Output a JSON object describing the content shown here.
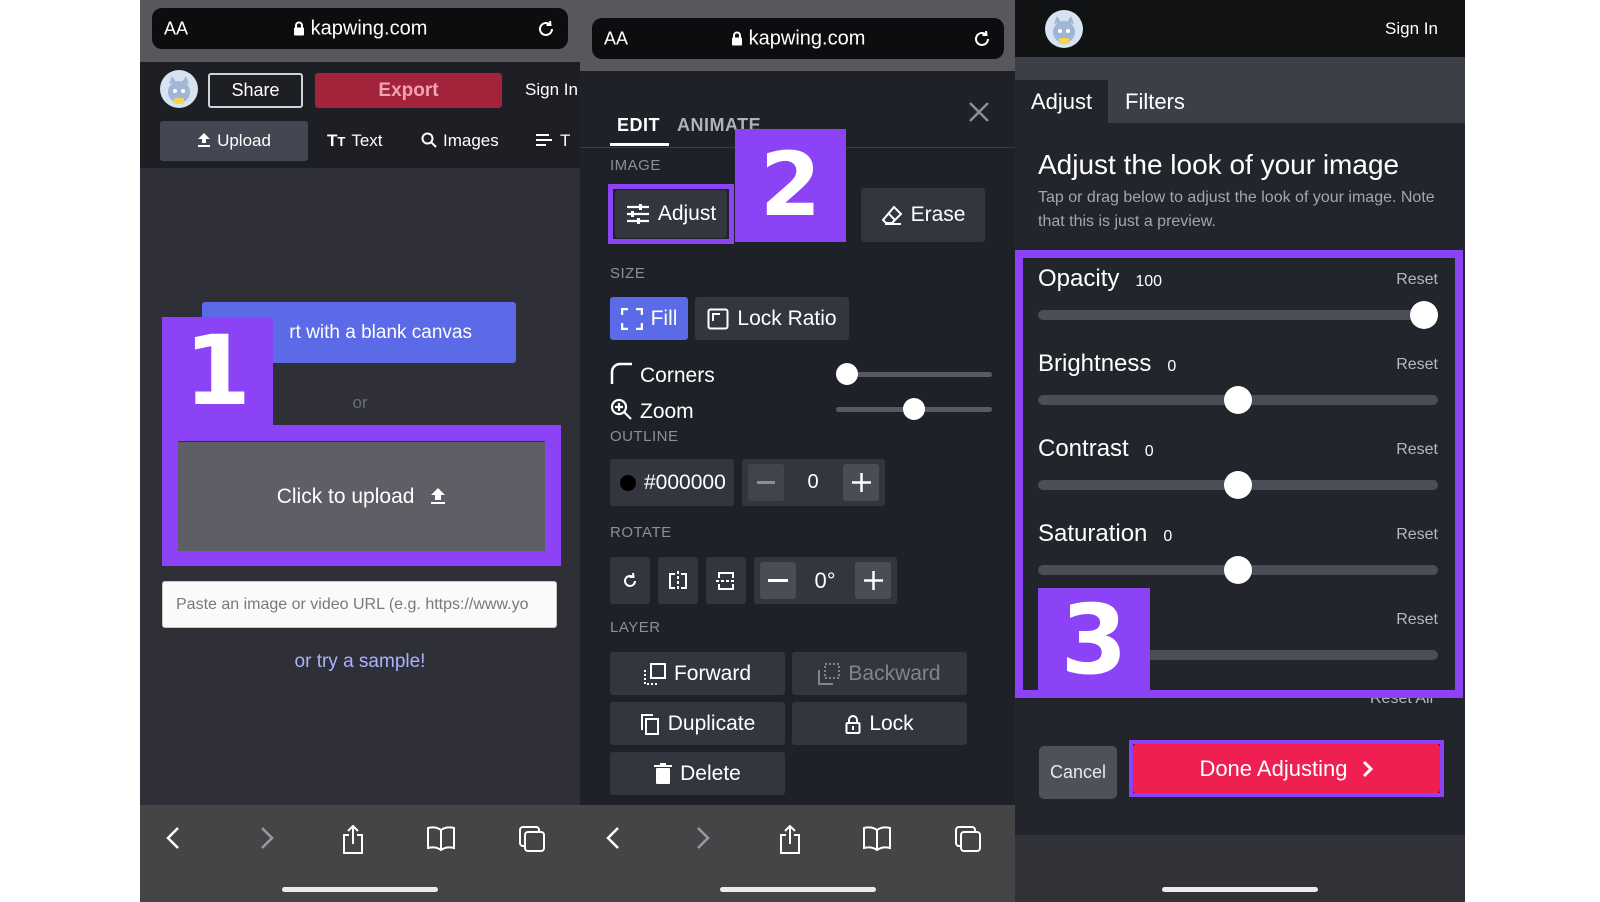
{
  "panel1": {
    "browser": {
      "text_size_label": "AA",
      "host": "kapwing.com"
    },
    "header": {
      "share_label": "Share",
      "export_label": "Export",
      "signin_label": "Sign In"
    },
    "tabs": [
      {
        "label": "Upload"
      },
      {
        "label": "Text"
      },
      {
        "label": "Images"
      },
      {
        "label": "T"
      }
    ],
    "blank_canvas_label": "rt with a blank canvas",
    "or_label": "or",
    "upload_label": "Click to upload",
    "url_placeholder": "Paste an image or video URL (e.g. https://www.yo",
    "sample_link": "or try a sample!",
    "callout_number": "1"
  },
  "panel2": {
    "browser": {
      "text_size_label": "AA",
      "host": "kapwing.com"
    },
    "tabs": {
      "edit": "EDIT",
      "animate": "ANIMATE"
    },
    "sections": {
      "image": "IMAGE",
      "size": "SIZE",
      "outline": "OUTLINE",
      "rotate": "ROTATE",
      "layer": "LAYER"
    },
    "image_buttons": {
      "adjust": "Adjust",
      "erase": "Erase"
    },
    "size_buttons": {
      "fill": "Fill",
      "lock_ratio": "Lock Ratio"
    },
    "corners_label": "Corners",
    "zoom_label": "Zoom",
    "corners_level": 0.0,
    "zoom_level": 0.5,
    "outline": {
      "color": "#000000",
      "color_label": "#000000",
      "width": "0"
    },
    "rotate": {
      "degrees": "0°"
    },
    "layer_buttons": {
      "forward": "Forward",
      "backward": "Backward",
      "duplicate": "Duplicate",
      "lock": "Lock",
      "delete": "Delete"
    },
    "callout_number": "2"
  },
  "panel3": {
    "signin_label": "Sign In",
    "tabs": {
      "adjust": "Adjust",
      "filters": "Filters"
    },
    "title": "Adjust the look of your image",
    "description": "Tap or drag below to adjust the look of your image. Note that this is just a preview.",
    "rows": [
      {
        "label": "Opacity",
        "value": "100",
        "reset": "Reset",
        "level": 1.0
      },
      {
        "label": "Brightness",
        "value": "0",
        "reset": "Reset",
        "level": 0.5
      },
      {
        "label": "Contrast",
        "value": "0",
        "reset": "Reset",
        "level": 0.5
      },
      {
        "label": "Saturation",
        "value": "0",
        "reset": "Reset",
        "level": 0.5
      },
      {
        "label": "",
        "value": "",
        "reset": "Reset",
        "level": 0.0
      }
    ],
    "reset_all_label": "Reset All",
    "cancel_label": "Cancel",
    "done_label": "Done Adjusting",
    "callout_number": "3"
  },
  "colors": {
    "callout_purple": "#8b43f5",
    "export_red": "#a3233b",
    "done_red": "#ef2051",
    "blank_blue": "#5b6ae6",
    "fill_blue": "#5b6ae6",
    "link_lavender": "#a9b2ff"
  }
}
